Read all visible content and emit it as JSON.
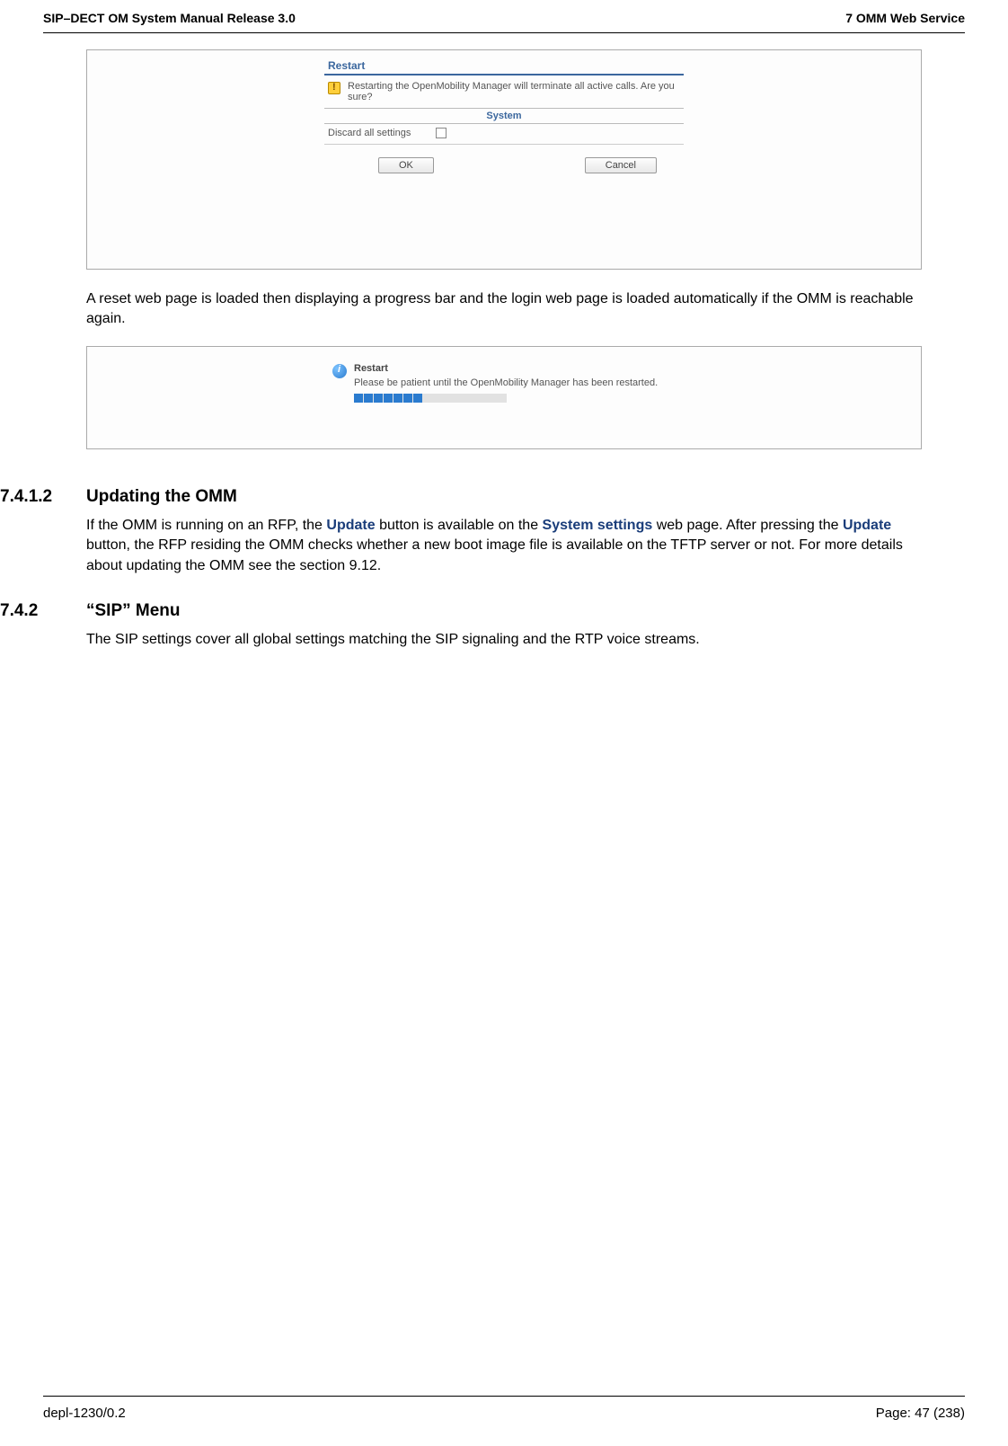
{
  "header": {
    "left": "SIP–DECT OM System Manual Release 3.0",
    "right": "7 OMM Web Service"
  },
  "dialog1": {
    "title": "Restart",
    "message": "Restarting the OpenMobility Manager will terminate all active calls. Are you sure?",
    "systemLabel": "System",
    "discardLabel": "Discard all settings",
    "okLabel": "OK",
    "cancelLabel": "Cancel"
  },
  "para1": "A reset web page is loaded then displaying a progress bar and the login web page is loaded automatically if the OMM is reachable again.",
  "dialog2": {
    "title": "Restart",
    "message": "Please be patient until the OpenMobility Manager has been restarted."
  },
  "sections": {
    "s1": {
      "num": "7.4.1.2",
      "title": "Updating the OMM",
      "p_a": "If the OMM is running on an RFP, the ",
      "update": "Update",
      "p_b": " button is available on the ",
      "settings": "System settings",
      "p_c": " web page. After pressing the ",
      "p_d": " button, the RFP residing the OMM checks whether a new boot image file is available on the TFTP server or not. For more details about updating the OMM see the section 9.12."
    },
    "s2": {
      "num": "7.4.2",
      "title": "“SIP” Menu",
      "para": "The SIP settings cover all global settings matching the SIP signaling and the RTP voice streams."
    }
  },
  "footer": {
    "left": "depl-1230/0.2",
    "right": "Page: 47 (238)"
  }
}
